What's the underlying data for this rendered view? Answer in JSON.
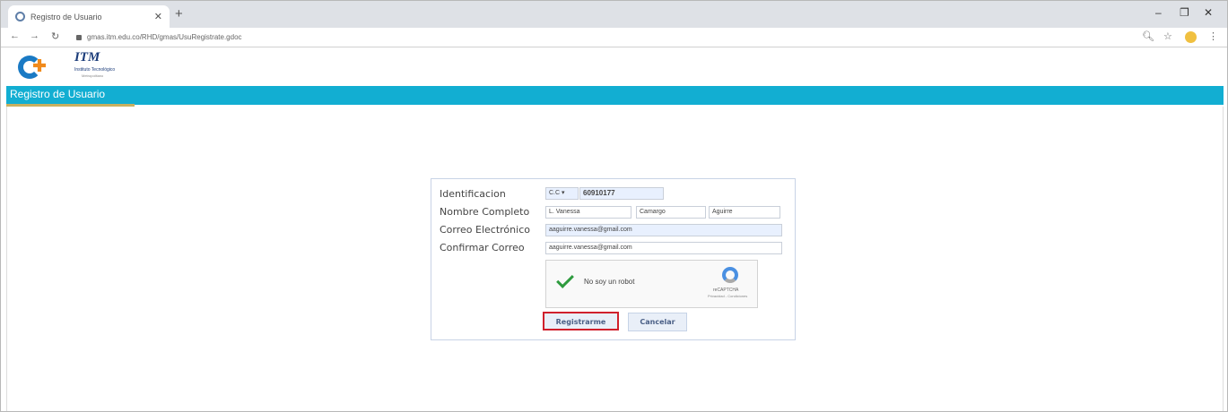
{
  "browser": {
    "tab_title": "Registro de Usuario",
    "new_tab": "+",
    "url": "gmas.itm.edu.co/RHD/gmas/UsuRegistrate.gdoc",
    "minimize": "‒",
    "restore": "❐",
    "close": "✕",
    "tab_close": "✕"
  },
  "header": {
    "logo_itm": "ITM",
    "logo_sub": "Instituto Tecnológico",
    "logo_sub2": "Metropolitano"
  },
  "bar": {
    "title": "Registro de Usuario"
  },
  "form": {
    "identificacion_label": "Identificacion",
    "id_type": "C.C ▾",
    "id_number": "60910177",
    "nombre_label": "Nombre Completo",
    "nombre_1": "L. Vanessa",
    "nombre_2": "Camargo",
    "nombre_3": "Aguirre",
    "correo_label": "Correo Electrónico",
    "correo_value": "aaguirre.vanessa@gmail.com",
    "confirmar_label": "Confirmar Correo",
    "confirmar_value": "aaguirre.vanessa@gmail.com",
    "captcha_text": "No soy un robot",
    "captcha_brand": "reCAPTCHA",
    "captcha_links": "Privacidad - Condiciones",
    "register_button": "Registrarme",
    "cancel_button": "Cancelar"
  }
}
